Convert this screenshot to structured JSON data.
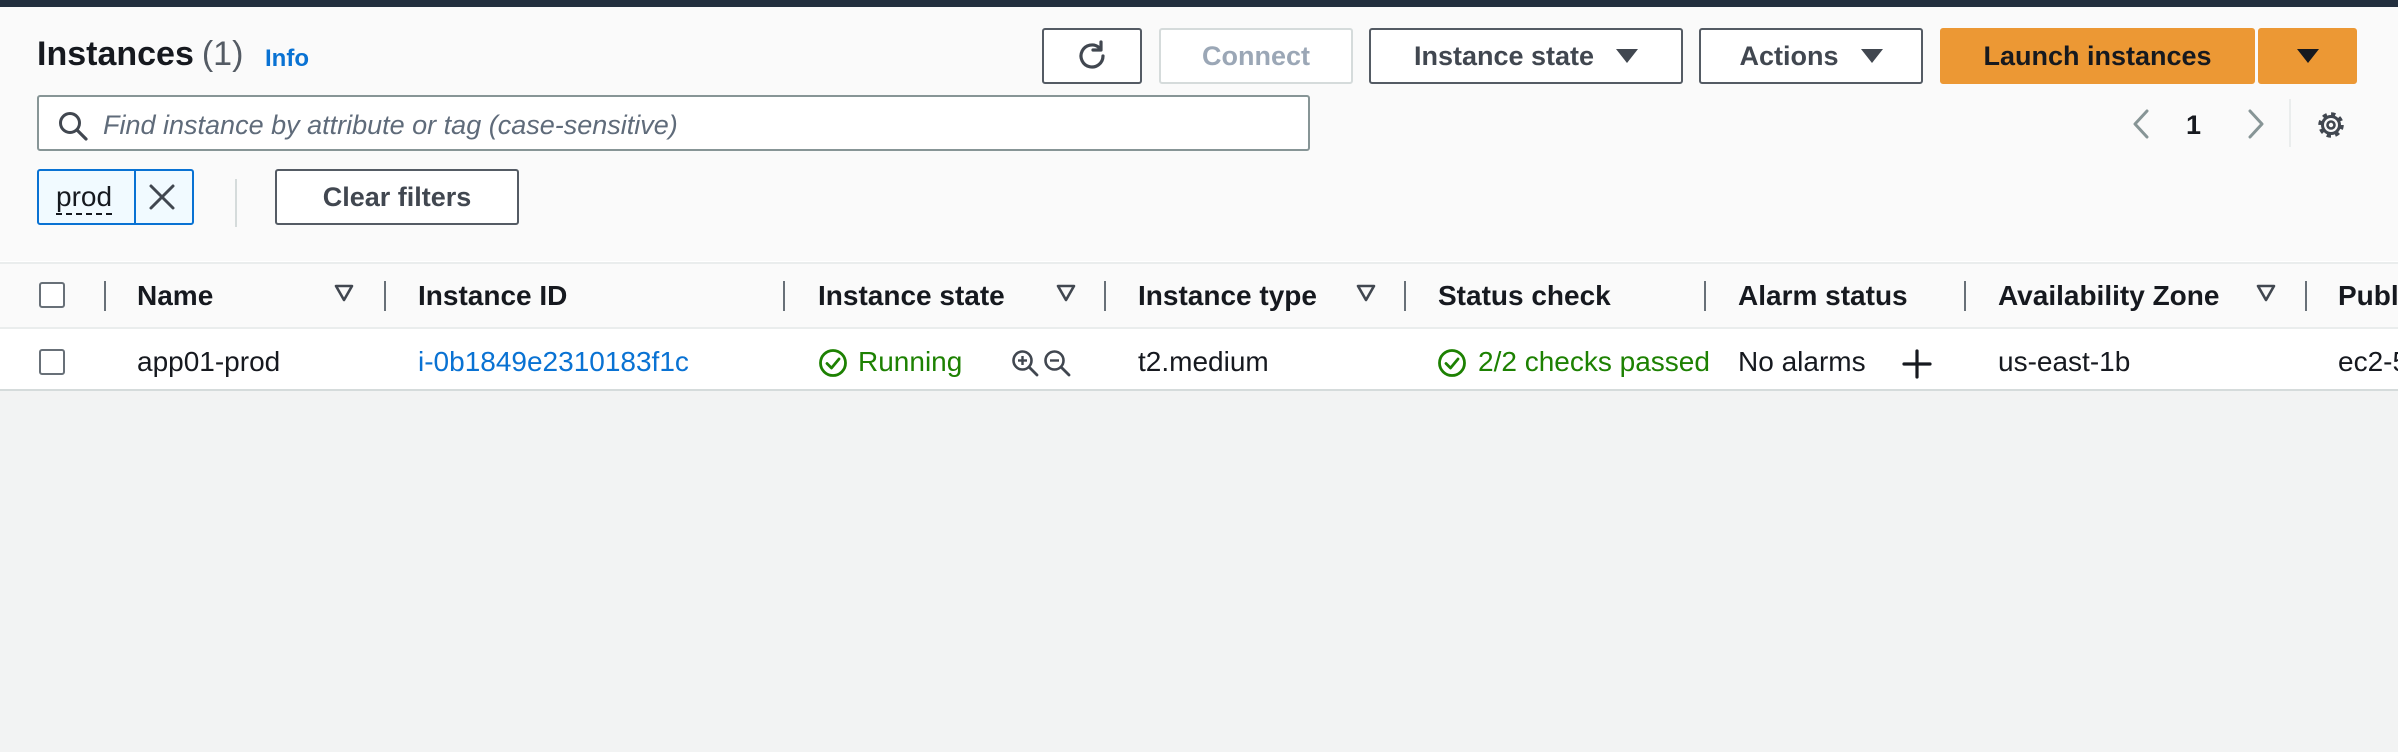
{
  "header": {
    "title": "Instances",
    "count": "(1)",
    "info_label": "Info"
  },
  "toolbar": {
    "connect_label": "Connect",
    "instance_state_label": "Instance state",
    "actions_label": "Actions",
    "launch_label": "Launch instances"
  },
  "search": {
    "placeholder": "Find instance by attribute or tag (case-sensitive)"
  },
  "pagination": {
    "current_page": "1"
  },
  "filters": {
    "token": "prod",
    "clear_label": "Clear filters"
  },
  "table": {
    "columns": [
      "Name",
      "Instance ID",
      "Instance state",
      "Instance type",
      "Status check",
      "Alarm status",
      "Availability Zone",
      "Publ"
    ],
    "rows": [
      {
        "name": "app01-prod",
        "instance_id": "i-0b1849e2310183f1c",
        "state": "Running",
        "type": "t2.medium",
        "status_check": "2/2 checks passed",
        "alarm": "No alarms",
        "az": "us-east-1b",
        "public": "ec2-5"
      }
    ]
  },
  "colors": {
    "accent": "#ec9834",
    "link": "#0972d3",
    "success": "#1d8102",
    "topbar": "#232f3e"
  },
  "icons": [
    "refresh-icon",
    "caret-down-icon",
    "search-icon",
    "chevron-left-icon",
    "chevron-right-icon",
    "settings-gear-icon",
    "close-icon",
    "sort-icon",
    "check-circle-icon",
    "zoom-in-icon",
    "zoom-out-icon",
    "plus-icon"
  ]
}
